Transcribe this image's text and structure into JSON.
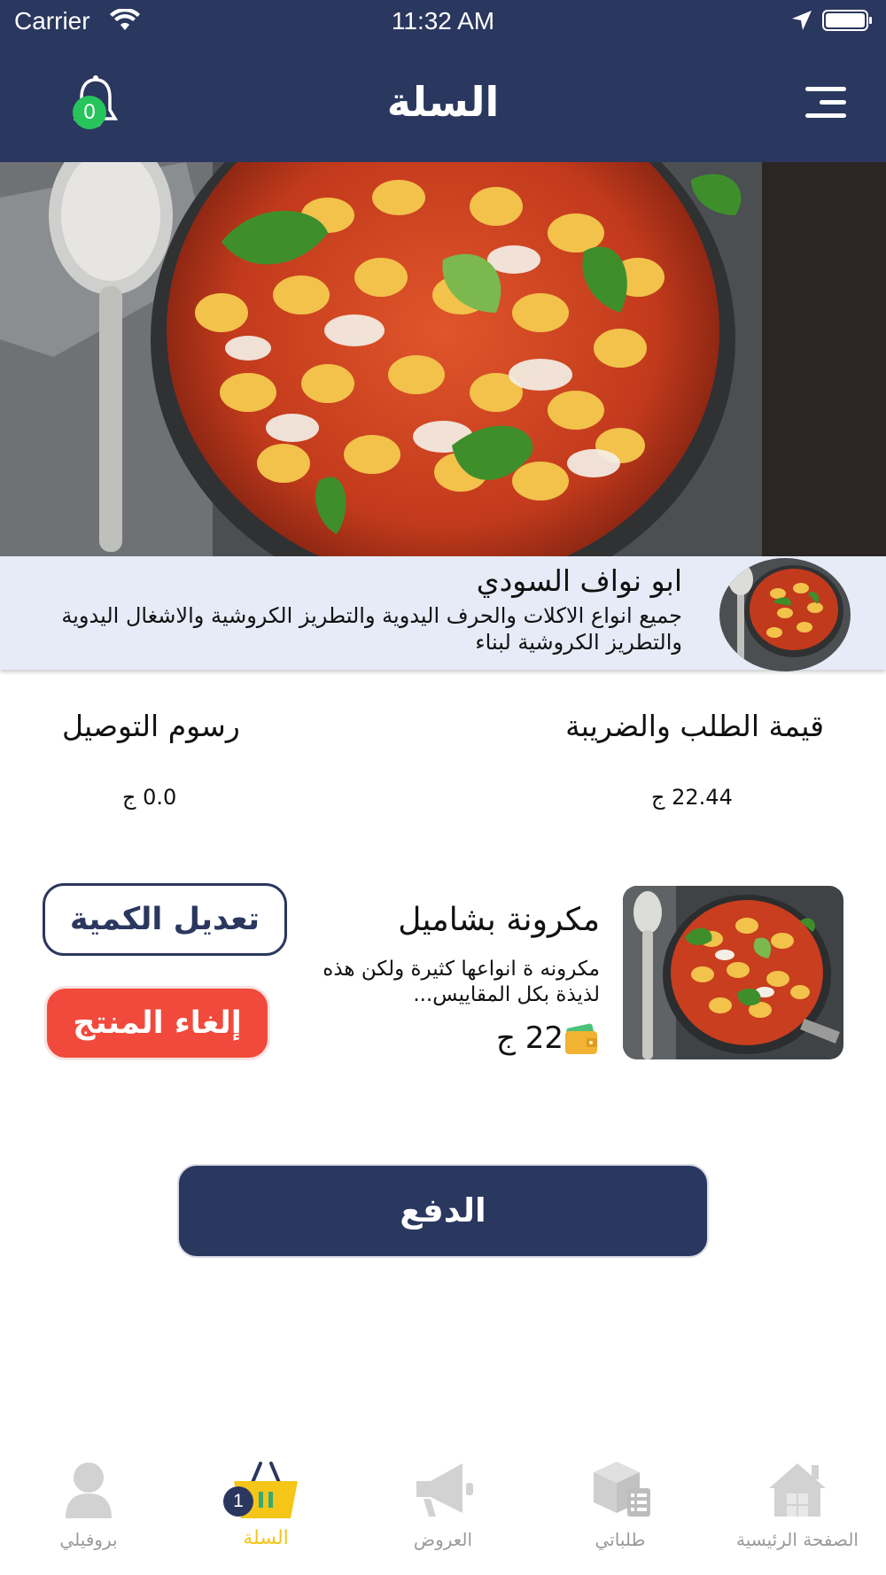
{
  "status_bar": {
    "carrier": "Carrier",
    "time": "11:32 AM"
  },
  "header": {
    "title": "السلة",
    "notification_count": "0"
  },
  "store": {
    "name": "ابو نواف السودي",
    "description": "جميع انواع الاكلات والحرف اليدوية والتطريز الكروشية والاشغال اليدوية والتطريز الكروشية لبناء"
  },
  "totals": {
    "order_label": "قيمة الطلب والضريبة",
    "order_value": "22.44 ج",
    "delivery_label": "رسوم التوصيل",
    "delivery_value": "0.0 ج"
  },
  "product": {
    "name": "مكرونة بشاميل",
    "description": "مكرونه ة انواعها كثيرة ولكن هذه لذيذة بكل المقاييس...",
    "price": "22 ج",
    "edit_quantity_label": "تعديل الكمية",
    "remove_label": "إلغاء المنتج"
  },
  "pay_button_label": "الدفع",
  "tab_bar": {
    "cart_badge": "1",
    "tabs": [
      {
        "label": "بروفيلي",
        "icon": "profile-icon"
      },
      {
        "label": "السلة",
        "icon": "basket-icon",
        "active": true
      },
      {
        "label": "العروض",
        "icon": "megaphone-icon"
      },
      {
        "label": "طلباتي",
        "icon": "orders-box-icon"
      },
      {
        "label": "الصفحة الرئيسية",
        "icon": "home-icon"
      }
    ]
  },
  "colors": {
    "primary": "#2a375f",
    "danger": "#f14a3c",
    "accent": "#f5c518",
    "badge_green": "#27c45b",
    "store_bar_bg": "#e6ebf7"
  }
}
